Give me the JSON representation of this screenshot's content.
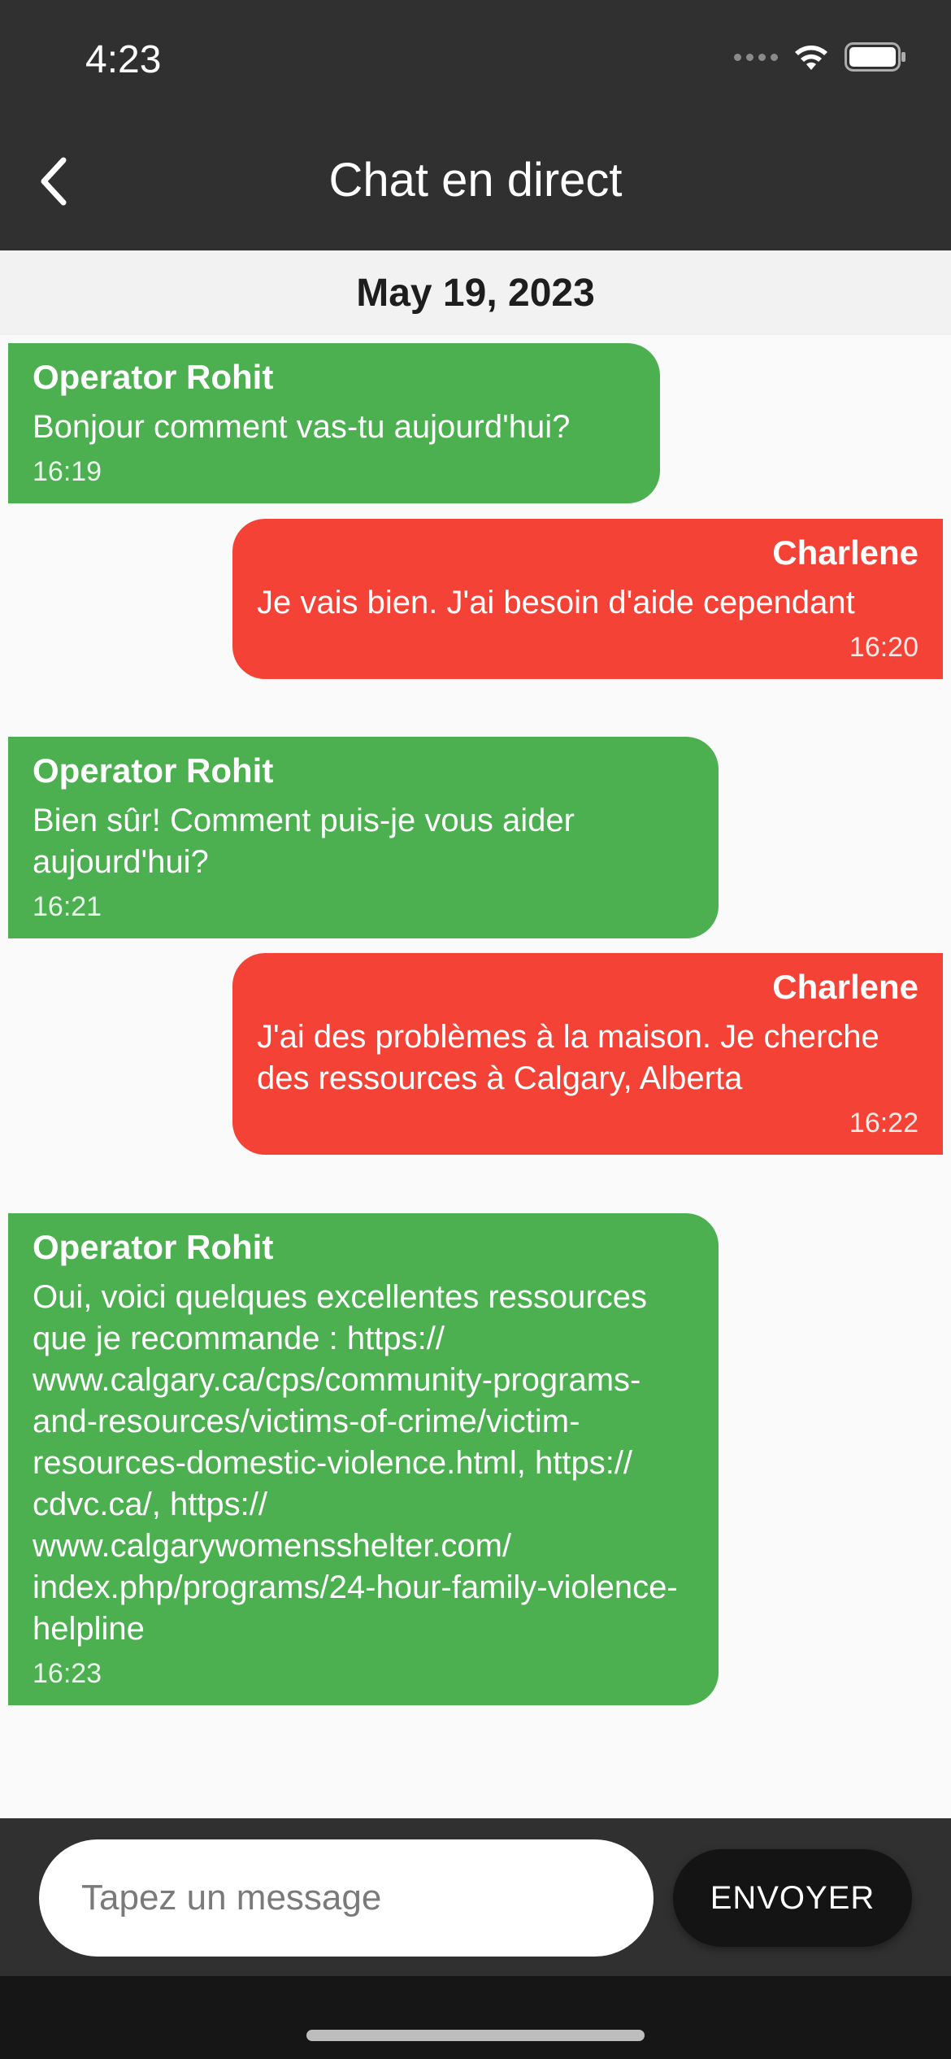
{
  "status_bar": {
    "time": "4:23",
    "icons": [
      "signal-dots-icon",
      "wifi-icon",
      "battery-icon"
    ]
  },
  "app_bar": {
    "back_icon": "chevron-left-icon",
    "title": "Chat en direct"
  },
  "date_header": "May 19, 2023",
  "colors": {
    "operator_bubble": "#4caf50",
    "user_bubble": "#f44336",
    "header": "#303030"
  },
  "messages": [
    {
      "sender": "Operator Rohit",
      "text": "Bonjour comment vas-tu aujourd'hui?",
      "time": "16:19",
      "side": "left"
    },
    {
      "sender": "Charlene",
      "text": "Je vais bien. J'ai besoin d'aide cependant",
      "time": "16:20",
      "side": "right"
    },
    {
      "sender": "Operator Rohit",
      "text": "Bien sûr! Comment puis-je vous aider aujourd'hui?",
      "time": "16:21",
      "side": "left"
    },
    {
      "sender": "Charlene",
      "text": "J'ai des problèmes à la maison. Je cherche des ressources à Calgary, Alberta",
      "time": "16:22",
      "side": "right"
    },
    {
      "sender": "Operator Rohit",
      "text": "Oui, voici quelques excellentes ressources que je recommande : https:// www.calgary.ca/cps/community-programs-and-resources/victims-of-crime/victim-resources-domestic-violence.html, https:// cdvc.ca/, https:// www.calgarywomensshelter.com/ index.php/programs/24-hour-family-violence-helpline",
      "time": "16:23",
      "side": "left"
    }
  ],
  "composer": {
    "placeholder": "Tapez un message",
    "value": "",
    "send_label": "ENVOYER"
  }
}
